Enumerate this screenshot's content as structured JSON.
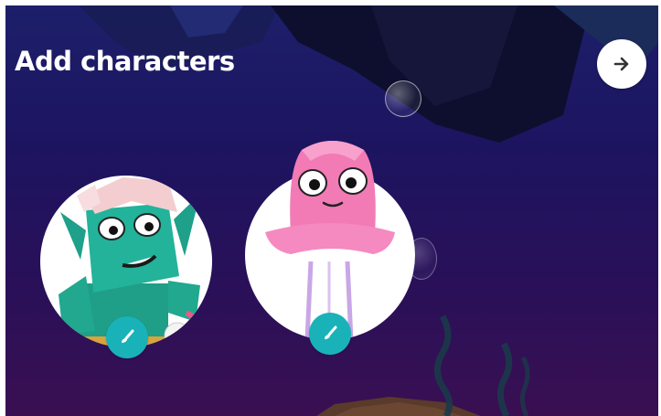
{
  "screen": {
    "title": "Add characters"
  },
  "nav": {
    "next_icon": "arrow-right-icon"
  },
  "characters": [
    {
      "name": "goblin",
      "edit_icon": "paintbrush-icon"
    },
    {
      "name": "jellyfish",
      "edit_icon": "paintbrush-icon"
    }
  ],
  "colors": {
    "accent": "#19b2b8",
    "background_top": "#1d1f6a",
    "background_bottom": "#3a0f52",
    "goblin_skin": "#22b39a",
    "jellyfish_pink": "#f27bb5"
  }
}
